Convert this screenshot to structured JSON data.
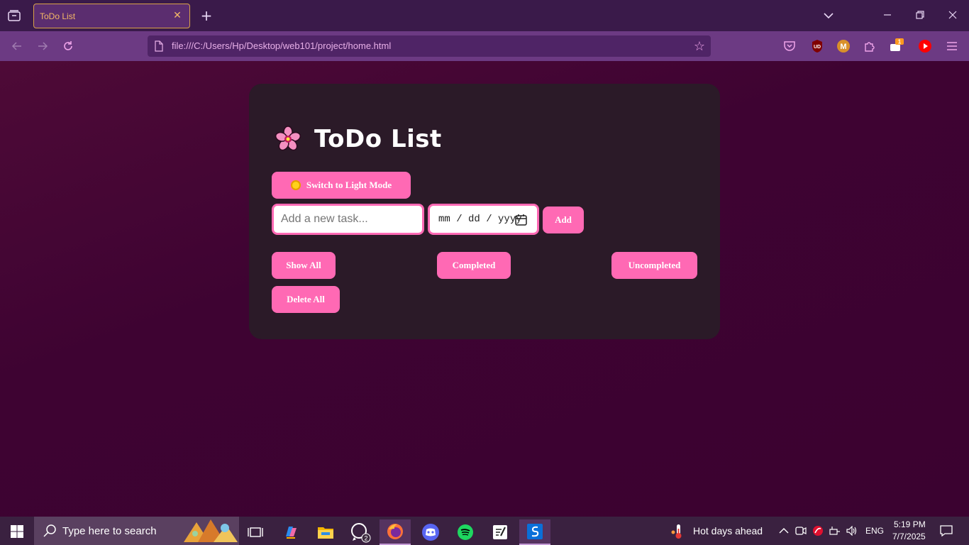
{
  "browser": {
    "tab_title": "ToDo List",
    "tab_close": "✕",
    "new_tab": "+",
    "url": "file:///C:/Users/Hp/Desktop/web101/project/home.html",
    "bookmark_star": "☆",
    "extensions": [
      {
        "name": "ublock",
        "label": "UD",
        "color": "#c0142f"
      },
      {
        "name": "m-extension",
        "label": "M",
        "color": "#d9902a"
      },
      {
        "name": "notify",
        "badge": "1"
      }
    ]
  },
  "app": {
    "heading": "ToDo List",
    "theme_toggle_label": "Switch to Light Mode",
    "task_placeholder": "Add a new task...",
    "date_placeholder": "mm / dd / yyyy",
    "add_label": "Add",
    "filters": {
      "show_all": "Show All",
      "completed": "Completed",
      "uncompleted": "Uncompleted"
    },
    "delete_all_label": "Delete All",
    "accent_color": "#ff69b4"
  },
  "taskbar": {
    "search_placeholder": "Type here to search",
    "whatsapp_badge": "2",
    "weather_text": "Hot days ahead",
    "language": "ENG",
    "time": "5:19 PM",
    "date": "7/7/2025"
  }
}
